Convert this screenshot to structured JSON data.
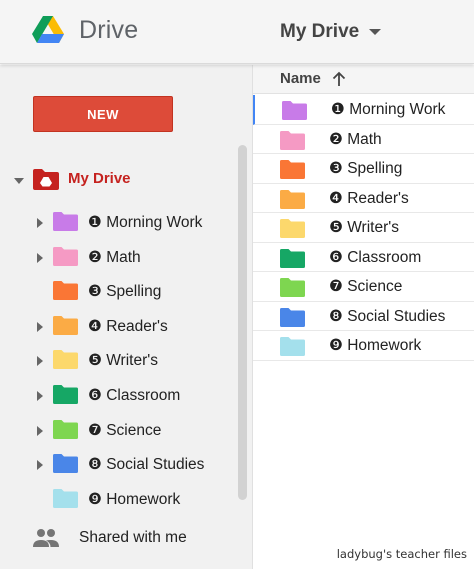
{
  "header": {
    "brand": "Drive",
    "title": "My Drive",
    "logo_icon": "google-drive-logo"
  },
  "sidebar": {
    "new_label": "NEW",
    "root_label": "My Drive",
    "root_color": "#c5221f",
    "items": [
      {
        "label": "❶ Morning Work",
        "color": "#c87be8",
        "expandable": true
      },
      {
        "label": "❷ Math",
        "color": "#f59ac4",
        "expandable": true
      },
      {
        "label": "❸ Spelling",
        "color": "#fa7635",
        "expandable": false
      },
      {
        "label": "❹ Reader's",
        "color": "#fbab45",
        "expandable": true
      },
      {
        "label": "❺ Writer's",
        "color": "#fcd86c",
        "expandable": true
      },
      {
        "label": "❻ Classroom",
        "color": "#16a765",
        "expandable": true
      },
      {
        "label": "❼ Science",
        "color": "#7ed650",
        "expandable": true
      },
      {
        "label": "❽ Social Studies",
        "color": "#4a86e8",
        "expandable": true
      },
      {
        "label": "❾ Homework",
        "color": "#a4e0ec",
        "expandable": false
      }
    ],
    "shared_label": "Shared with me"
  },
  "main": {
    "column_name": "Name",
    "sort_direction": "ascending",
    "rows": [
      {
        "label": "❶ Morning Work",
        "color": "#c87be8"
      },
      {
        "label": "❷ Math",
        "color": "#f59ac4"
      },
      {
        "label": "❸ Spelling",
        "color": "#fa7635"
      },
      {
        "label": "❹ Reader's",
        "color": "#fbab45"
      },
      {
        "label": "❺ Writer's",
        "color": "#fcd86c"
      },
      {
        "label": "❻ Classroom",
        "color": "#16a765"
      },
      {
        "label": "❼ Science",
        "color": "#7ed650"
      },
      {
        "label": "❽ Social Studies",
        "color": "#4a86e8"
      },
      {
        "label": "❾ Homework",
        "color": "#a4e0ec"
      }
    ]
  },
  "credit": "ladybug's teacher files"
}
